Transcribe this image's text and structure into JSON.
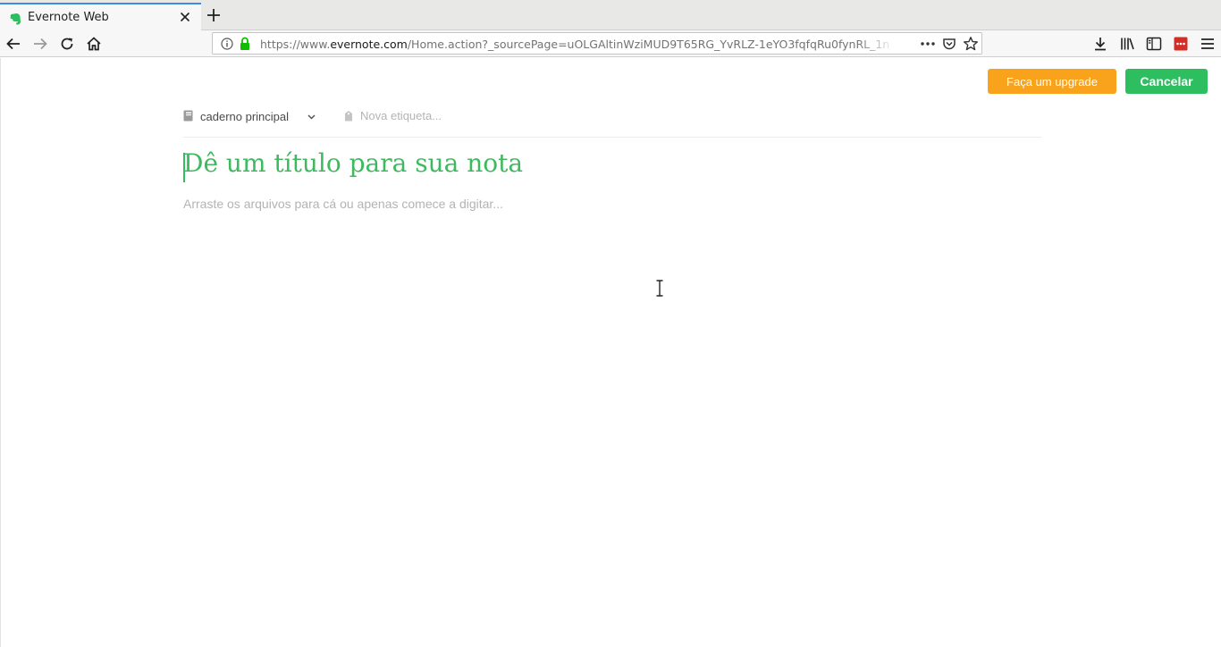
{
  "browser": {
    "tab": {
      "title": "Evernote Web",
      "favicon": "evernote-elephant-icon"
    },
    "new_tab": "plus-icon",
    "nav": {
      "back": "arrow-left-icon",
      "forward": "arrow-right-icon",
      "reload": "reload-icon",
      "home": "home-icon"
    },
    "url": {
      "scheme": "https://www.",
      "domain": "evernote.com",
      "path": "/Home.action?_sourcePage=uOLGAltinWziMUD9T65RG_YvRLZ-1eYO3fqfqRu0fynRL_1n"
    },
    "toolbar_icons": [
      "download-icon",
      "library-icon",
      "sidebar-icon",
      "lastpass-icon",
      "hamburger-menu-icon"
    ],
    "accent_color": "#3a8ee6"
  },
  "editor": {
    "upgrade_label": "Faça um upgrade",
    "cancel_label": "Cancelar",
    "notebook_label": "caderno principal",
    "tag_placeholder": "Nova etiqueta...",
    "title_placeholder": "Dê um título para sua nota",
    "body_placeholder": "Arraste os arquivos para cá ou apenas comece a digitar...",
    "colors": {
      "brand_green": "#2dbe60",
      "upgrade_orange": "#f9a21b"
    }
  }
}
